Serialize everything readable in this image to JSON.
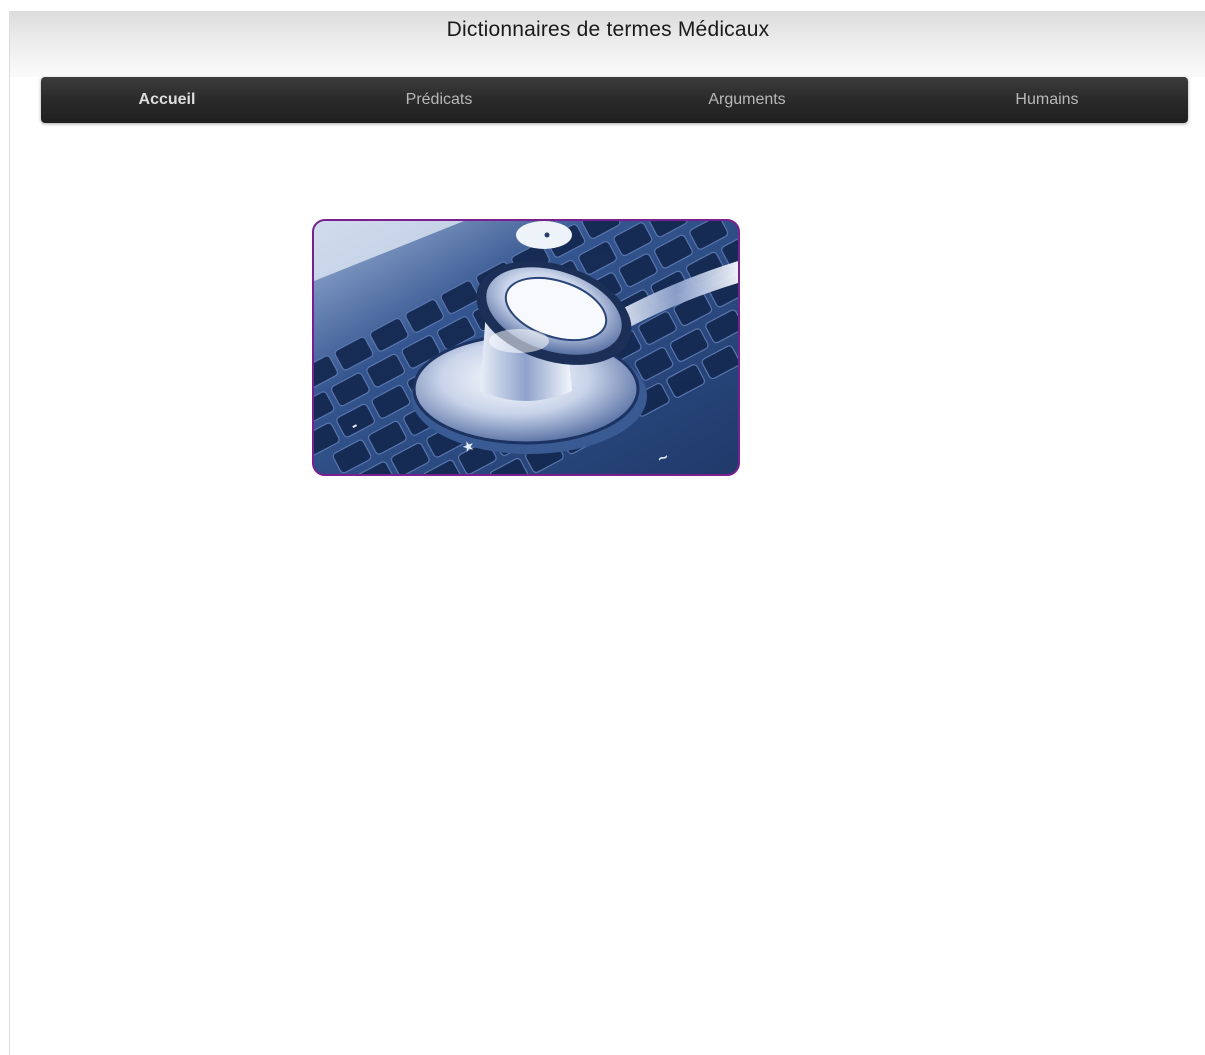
{
  "header": {
    "title": "Dictionnaires de termes Médicaux"
  },
  "nav": {
    "items": [
      {
        "label": "Accueil",
        "active": true
      },
      {
        "label": "Prédicats",
        "active": false
      },
      {
        "label": "Arguments",
        "active": false
      },
      {
        "label": "Humains",
        "active": false
      }
    ]
  },
  "hero": {
    "image": "stethoscope-on-keyboard-image",
    "border_color": "#7a1f8f",
    "tint": "#2d4f8a"
  },
  "colors": {
    "navbar": "#2a2a2a",
    "nav_text": "#b8b8b8",
    "nav_active_text": "#dddddd",
    "header_gradient_top": "#dcdcdc"
  }
}
